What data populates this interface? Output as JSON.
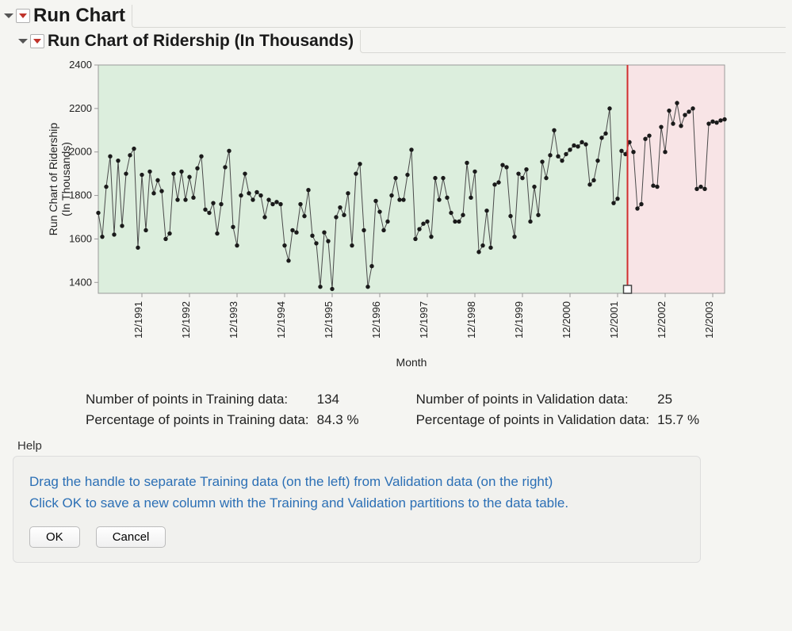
{
  "panel1": {
    "title": "Run Chart"
  },
  "panel2": {
    "title": "Run Chart of Ridership (In Thousands)"
  },
  "chart_data": {
    "type": "line",
    "xlabel": "Month",
    "ylabel": "Run Chart of Ridership\n(In Thousands)",
    "ylim": [
      1350,
      2400
    ],
    "yticks": [
      1400,
      1600,
      1800,
      2000,
      2200,
      2400
    ],
    "x_tick_labels": [
      "12/1991",
      "12/1992",
      "12/1993",
      "12/1994",
      "12/1995",
      "12/1996",
      "12/1997",
      "12/1998",
      "12/1999",
      "12/2000",
      "12/2001",
      "12/2002",
      "12/2003"
    ],
    "split_index": 134,
    "n": 159,
    "values": [
      1720,
      1610,
      1840,
      1980,
      1620,
      1960,
      1660,
      1900,
      1985,
      2015,
      1560,
      1895,
      1640,
      1910,
      1810,
      1870,
      1820,
      1600,
      1625,
      1900,
      1780,
      1910,
      1780,
      1885,
      1790,
      1925,
      1980,
      1735,
      1720,
      1765,
      1625,
      1760,
      1930,
      2005,
      1655,
      1570,
      1800,
      1900,
      1810,
      1780,
      1815,
      1800,
      1700,
      1780,
      1760,
      1770,
      1760,
      1570,
      1500,
      1640,
      1630,
      1760,
      1705,
      1825,
      1615,
      1580,
      1380,
      1630,
      1590,
      1370,
      1700,
      1745,
      1710,
      1810,
      1570,
      1900,
      1945,
      1640,
      1380,
      1475,
      1775,
      1725,
      1640,
      1680,
      1800,
      1880,
      1780,
      1780,
      1895,
      2010,
      1600,
      1645,
      1670,
      1680,
      1610,
      1880,
      1780,
      1880,
      1790,
      1720,
      1680,
      1680,
      1710,
      1950,
      1790,
      1910,
      1540,
      1570,
      1730,
      1560,
      1850,
      1860,
      1940,
      1930,
      1705,
      1610,
      1900,
      1880,
      1920,
      1680,
      1840,
      1710,
      1955,
      1880,
      1985,
      2100,
      1980,
      1960,
      1990,
      2010,
      2030,
      2025,
      2045,
      2035,
      1850,
      1870,
      1960,
      2065,
      2085,
      2200,
      1765,
      1785,
      2005,
      1990,
      2045,
      2000,
      1740,
      1760,
      2060,
      2075,
      1845,
      1840,
      2115,
      2000,
      2190,
      2130,
      2225,
      2120,
      2170,
      2185,
      2200,
      1830,
      1840,
      1830,
      2130,
      2140,
      2135,
      2145,
      2150
    ]
  },
  "stats": {
    "train": {
      "n_label": "Number of points in Training data:",
      "n_value": "134",
      "pct_label": "Percentage of points in Training data:",
      "pct_value": "84.3 %"
    },
    "valid": {
      "n_label": "Number of points in Validation data:",
      "n_value": "25",
      "pct_label": "Percentage of points in Validation data:",
      "pct_value": "15.7 %"
    }
  },
  "help": {
    "label": "Help",
    "line1": "Drag the handle to separate Training data (on the left) from Validation data (on the right)",
    "line2": "Click OK to save a new column with the Training and Validation partitions to the data table.",
    "ok": "OK",
    "cancel": "Cancel"
  }
}
